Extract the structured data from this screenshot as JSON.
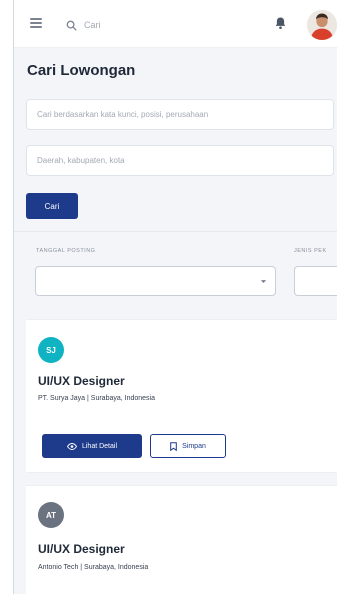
{
  "header": {
    "search_placeholder": "Cari"
  },
  "page": {
    "title": "Cari Lowongan"
  },
  "search_form": {
    "keyword_placeholder": "Cari berdasarkan kata kunci, posisi, perusahaan",
    "location_placeholder": "Daerah, kabupaten, kota",
    "submit_label": "Cari"
  },
  "filters": [
    {
      "label": "TANGGAL POSTING",
      "value": ""
    },
    {
      "label": "JENIS PEK",
      "value": ""
    }
  ],
  "jobs": [
    {
      "initials": "SJ",
      "avatar_color": "#10b3c2",
      "title": "UI/UX Designer",
      "company_line": "PT. Surya Jaya | Surabaya, Indonesia",
      "detail_label": "Lihat Detail",
      "save_label": "Simpan"
    },
    {
      "initials": "AT",
      "avatar_color": "#6b7280",
      "title": "UI/UX Designer",
      "company_line": "Antonio Tech | Surabaya, Indonesia"
    }
  ],
  "colors": {
    "primary": "#1e3a8a",
    "background": "#f3f5f9"
  },
  "icons": {
    "menu": "hamburger-menu-icon",
    "search": "search-icon",
    "notification": "bell-icon",
    "view": "eye-icon",
    "bookmark": "bookmark-icon",
    "dropdown": "chevron-down-icon"
  }
}
